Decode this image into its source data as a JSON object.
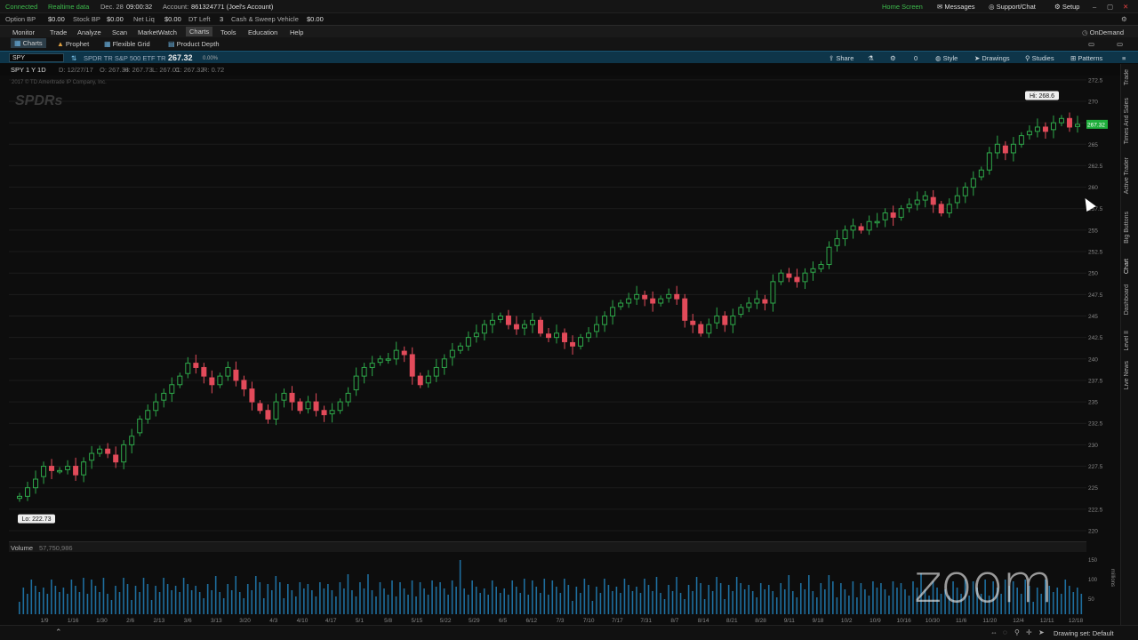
{
  "status": {
    "connected": "Connected",
    "realtime": "Realtime data",
    "date": "Dec. 28",
    "time": "09:00:32",
    "account_label": "Account:",
    "account": "861324771 (Joel's Account)",
    "option_bp_label": "Option BP",
    "option_bp": "$0.00",
    "stock_bp_label": "Stock BP",
    "stock_bp": "$0.00",
    "net_liq_label": "Net Liq",
    "net_liq": "$0.00",
    "dt_left_label": "DT Left",
    "dt_left": "3",
    "cash_label": "Cash & Sweep Vehicle",
    "cash": "$0.00",
    "home_screen": "Home Screen",
    "messages": "Messages",
    "support": "Support/Chat",
    "setup": "Setup"
  },
  "menu": [
    "Monitor",
    "Trade",
    "Analyze",
    "Scan",
    "MarketWatch",
    "Charts",
    "Tools",
    "Education",
    "Help"
  ],
  "menu_active": "Charts",
  "ondemand": "OnDemand",
  "subtabs": [
    "Charts",
    "Prophet",
    "Flexible Grid",
    "Product Depth"
  ],
  "toolbar": {
    "symbol": "SPY",
    "description": "SPDR TR S&P 500 ETF TR",
    "last": "267.32",
    "change": "0.00%",
    "share": "Share",
    "zero": "0",
    "style": "Style",
    "drawings": "Drawings",
    "studies": "Studies",
    "patterns": "Patterns"
  },
  "ohlc": {
    "label": "SPY 1 Y 1D",
    "date": "D: 12/27/17",
    "open": "O: 267.38",
    "high": "H: 267.73",
    "low": "L: 267.01",
    "close": "C: 267.32",
    "range": "R: 0.72"
  },
  "copyright": "2017 © TD Ameritrade IP Company, Inc.",
  "watermark": "SPDRs",
  "chart_data": {
    "type": "candlestick",
    "symbol": "SPY",
    "period": "1 Y 1D",
    "ylim": [
      220,
      273
    ],
    "y_ticks": [
      "272.5",
      "270",
      "267.5",
      "265",
      "262.5",
      "260",
      "257.5",
      "255",
      "252.5",
      "250",
      "247.5",
      "245",
      "242.5",
      "240",
      "237.5",
      "235",
      "232.5",
      "230",
      "227.5",
      "225",
      "222.5",
      "220"
    ],
    "hi_label": "Hi: 268.6",
    "lo_label": "Lo: 222.73",
    "last_price": "267.32",
    "x_ticks": [
      "1/9",
      "1/16",
      "1/30",
      "2/6",
      "2/13",
      "3/6",
      "3/13",
      "3/20",
      "4/3",
      "4/10",
      "4/17",
      "5/1",
      "5/8",
      "5/15",
      "5/22",
      "5/29",
      "6/5",
      "6/12",
      "7/3",
      "7/10",
      "7/17",
      "7/31",
      "8/7",
      "8/14",
      "8/21",
      "8/28",
      "9/11",
      "9/18",
      "10/2",
      "10/9",
      "10/16",
      "10/30",
      "11/6",
      "11/20",
      "12/4",
      "12/11",
      "12/18"
    ],
    "closes": [
      224,
      225,
      226,
      227.5,
      227,
      227,
      227.5,
      226.5,
      228,
      229,
      229.5,
      229,
      228,
      230,
      231,
      233,
      234,
      235,
      236,
      237,
      238,
      239.5,
      239,
      238,
      237,
      238,
      239,
      237.5,
      236.5,
      235,
      234,
      233,
      235,
      236,
      235,
      234,
      235,
      234,
      233.5,
      234,
      235,
      236,
      238,
      239,
      239.5,
      240,
      240,
      241,
      240.5,
      238,
      237,
      238,
      239,
      240,
      241,
      241.5,
      242.5,
      243,
      244,
      244.5,
      245,
      244,
      243.5,
      244,
      244.5,
      243,
      242.5,
      243,
      242,
      241.5,
      242.5,
      243,
      244,
      245,
      246,
      246.5,
      247,
      247.5,
      247,
      246.5,
      247,
      247.5,
      247,
      244.5,
      244,
      243,
      244,
      245,
      244,
      245,
      246,
      246.5,
      247,
      246.5,
      249,
      250,
      249.5,
      249,
      250,
      250.5,
      251,
      253,
      254,
      255,
      255.5,
      255,
      256,
      256,
      257,
      256.5,
      257.5,
      258,
      258.5,
      259,
      258,
      257,
      258,
      259,
      260,
      261,
      262,
      264,
      265,
      264,
      265,
      266,
      266.5,
      267,
      266.5,
      267.5,
      268,
      267,
      267.32
    ],
    "volume_label": "Volume",
    "volume": "57,750,986",
    "volume_axis": [
      "150",
      "100",
      "50"
    ],
    "volume_unit": "millions"
  },
  "rail": [
    "Trade",
    "Times And Sales",
    "Active Trader",
    "Big Buttons",
    "Chart",
    "Dashboard",
    "Level II",
    "Live News"
  ],
  "bottom": {
    "drawing_set": "Drawing set: Default"
  },
  "zoom_logo": "zoom"
}
